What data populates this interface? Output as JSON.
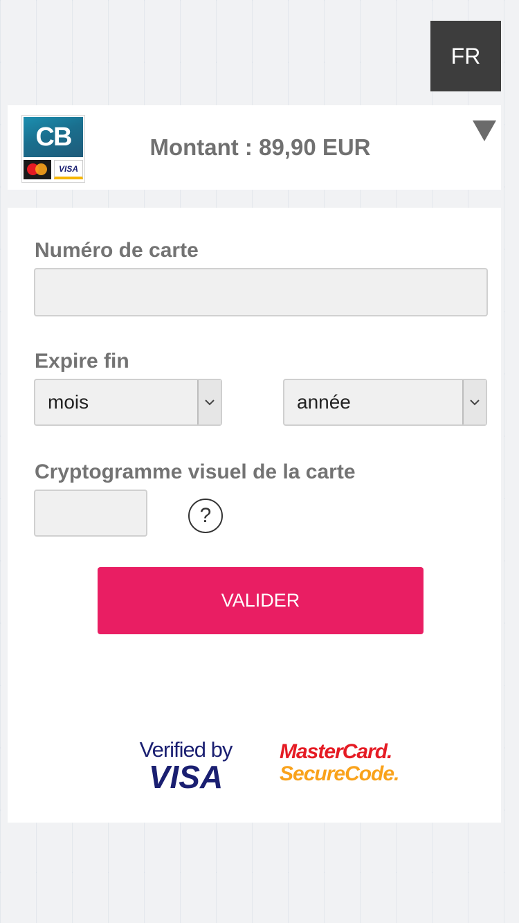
{
  "language": {
    "label": "FR"
  },
  "header": {
    "amount": "Montant : 89,90 EUR"
  },
  "logos": {
    "cb": "CB",
    "visa_mini": "VISA"
  },
  "form": {
    "card_number": {
      "label": "Numéro de carte",
      "value": ""
    },
    "expiry": {
      "label": "Expire fin",
      "month": "mois",
      "year": "année"
    },
    "cvv": {
      "label": "Cryptogramme visuel de la carte",
      "value": "",
      "help": "?"
    },
    "submit": "VALIDER"
  },
  "security": {
    "vbv_line1": "Verified by",
    "vbv_line2": "VISA",
    "mc_line1": "MasterCard.",
    "mc_line2": "SecureCode."
  },
  "colors": {
    "accent": "#e91e63",
    "dark": "#3d3d3d"
  }
}
